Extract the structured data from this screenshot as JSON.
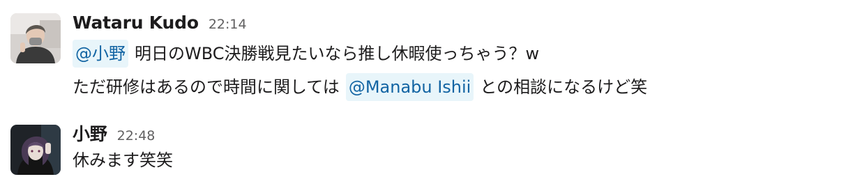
{
  "messages": [
    {
      "sender": "Wataru Kudo",
      "time": "22:14",
      "avatar_icon": "user-avatar-icon",
      "line1": {
        "mention": "@小野",
        "text": "明日のWBC決勝戦見たいなら推し休暇使っちゃう？w"
      },
      "line2": {
        "before": "ただ研修はあるので時間に関しては",
        "mention": "@Manabu Ishii",
        "after": "との相談になるけど笑"
      }
    },
    {
      "sender": "小野",
      "time": "22:48",
      "avatar_icon": "user-avatar-icon",
      "line1": {
        "text": "休みます笑笑"
      }
    }
  ],
  "colors": {
    "mention_bg": "#e8f5fa",
    "mention_text": "#1264a3",
    "timestamp": "#616061",
    "text": "#1d1c1d"
  }
}
